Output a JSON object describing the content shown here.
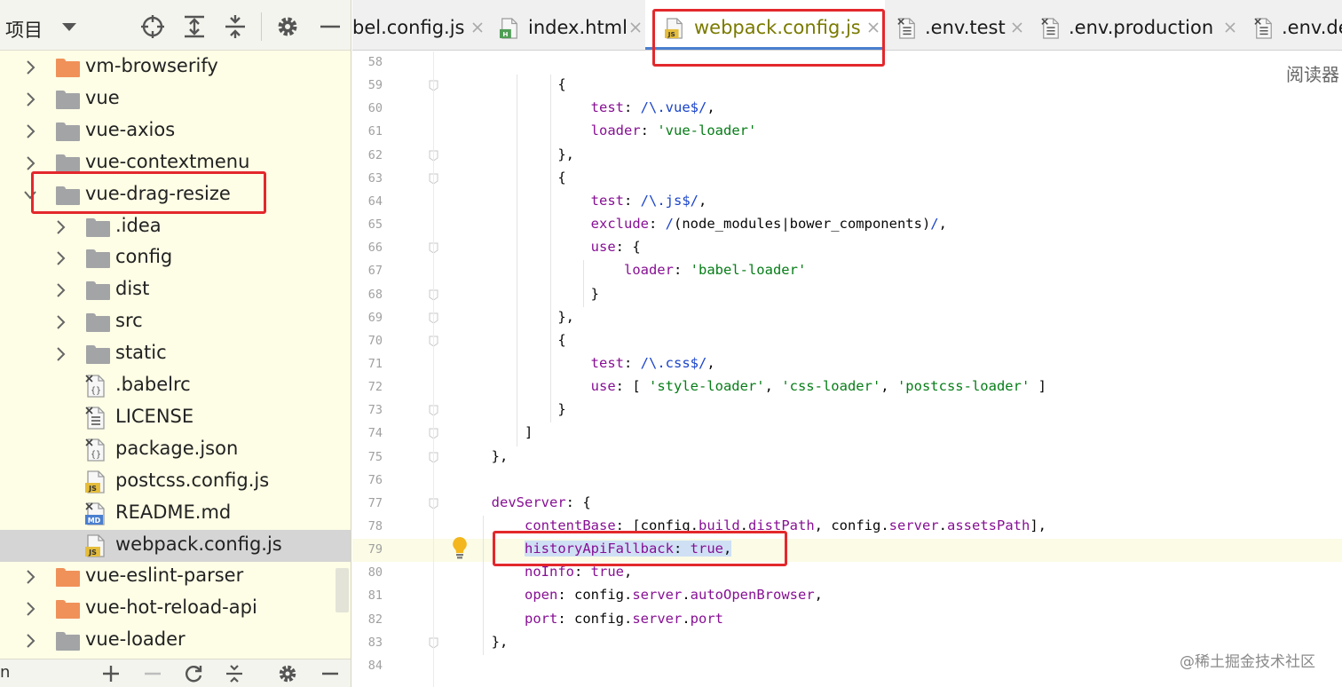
{
  "sidebar": {
    "header": {
      "title": "项目"
    },
    "icons": [
      "crosshair-icon",
      "expand-all-icon",
      "collapse-all-icon",
      "gear-icon",
      "minimize-icon"
    ],
    "tree": [
      {
        "label": "vm-browserify",
        "type": "folder",
        "color": "orange",
        "expanded": false,
        "depth": 0
      },
      {
        "label": "vue",
        "type": "folder",
        "color": "gray",
        "expanded": false,
        "depth": 0
      },
      {
        "label": "vue-axios",
        "type": "folder",
        "color": "gray",
        "expanded": false,
        "depth": 0
      },
      {
        "label": "vue-contextmenu",
        "type": "folder",
        "color": "gray",
        "expanded": false,
        "depth": 0
      },
      {
        "label": "vue-drag-resize",
        "type": "folder",
        "color": "gray",
        "expanded": true,
        "depth": 0,
        "highlighted": true
      },
      {
        "label": ".idea",
        "type": "folder",
        "color": "gray",
        "expanded": false,
        "depth": 1
      },
      {
        "label": "config",
        "type": "folder",
        "color": "gray",
        "expanded": false,
        "depth": 1
      },
      {
        "label": "dist",
        "type": "folder",
        "color": "gray",
        "expanded": false,
        "depth": 1
      },
      {
        "label": "src",
        "type": "folder",
        "color": "gray",
        "expanded": false,
        "depth": 1
      },
      {
        "label": "static",
        "type": "folder",
        "color": "gray",
        "expanded": false,
        "depth": 1
      },
      {
        "label": ".babelrc",
        "type": "file",
        "icon": "json-file-icon",
        "depth": 1
      },
      {
        "label": "LICENSE",
        "type": "file",
        "icon": "text-file-icon",
        "depth": 1
      },
      {
        "label": "package.json",
        "type": "file",
        "icon": "json-file-icon",
        "depth": 1
      },
      {
        "label": "postcss.config.js",
        "type": "file",
        "icon": "js-file-icon",
        "depth": 1
      },
      {
        "label": "README.md",
        "type": "file",
        "icon": "markdown-file-icon",
        "depth": 1
      },
      {
        "label": "webpack.config.js",
        "type": "file",
        "icon": "js-file-icon",
        "depth": 1,
        "selected": true
      },
      {
        "label": "vue-eslint-parser",
        "type": "folder",
        "color": "orange",
        "expanded": false,
        "depth": 0
      },
      {
        "label": "vue-hot-reload-api",
        "type": "folder",
        "color": "orange",
        "expanded": false,
        "depth": 0
      },
      {
        "label": "vue-loader",
        "type": "folder",
        "color": "gray",
        "expanded": false,
        "depth": 0
      }
    ],
    "bottom": {
      "text": "n",
      "icons": [
        "add-icon",
        "remove-icon",
        "refresh-icon",
        "collapse-icon",
        "gear-icon",
        "minimize-icon"
      ]
    }
  },
  "tabs": [
    {
      "label": "bel.config.js",
      "icon": "",
      "active": false
    },
    {
      "label": "index.html",
      "icon": "html-file-icon",
      "badge": "H",
      "active": false
    },
    {
      "label": "webpack.config.js",
      "icon": "js-file-icon",
      "badge": "JS",
      "active": true
    },
    {
      "label": ".env.test",
      "icon": "text-file-icon",
      "active": false
    },
    {
      "label": ".env.production",
      "icon": "text-file-icon",
      "active": false
    },
    {
      "label": ".env.de",
      "icon": "text-file-icon",
      "active": false
    }
  ],
  "editor": {
    "reader_label": "阅读器",
    "current_line": 79,
    "lines": [
      {
        "n": "58",
        "code": []
      },
      {
        "n": "59",
        "code": [
          [
            "",
            "          {"
          ]
        ]
      },
      {
        "n": "60",
        "code": [
          [
            "",
            "              "
          ],
          [
            "k",
            "test"
          ],
          [
            "",
            ": "
          ],
          [
            "rx",
            "/\\.vue$/"
          ],
          [
            "",
            ","
          ]
        ]
      },
      {
        "n": "61",
        "code": [
          [
            "",
            "              "
          ],
          [
            "k",
            "loader"
          ],
          [
            "",
            ": "
          ],
          [
            "s",
            "'vue-loader'"
          ]
        ]
      },
      {
        "n": "62",
        "code": [
          [
            "",
            "          },"
          ]
        ]
      },
      {
        "n": "63",
        "code": [
          [
            "",
            "          {"
          ]
        ]
      },
      {
        "n": "64",
        "code": [
          [
            "",
            "              "
          ],
          [
            "k",
            "test"
          ],
          [
            "",
            ": "
          ],
          [
            "rx",
            "/\\.js$/"
          ],
          [
            "",
            ","
          ]
        ]
      },
      {
        "n": "65",
        "code": [
          [
            "",
            "              "
          ],
          [
            "k",
            "exclude"
          ],
          [
            "",
            ": "
          ],
          [
            "rx",
            "/"
          ],
          [
            "",
            "(node_modules|bower_components)"
          ],
          [
            "rx",
            "/"
          ],
          [
            "",
            ","
          ]
        ]
      },
      {
        "n": "66",
        "code": [
          [
            "",
            "              "
          ],
          [
            "k",
            "use"
          ],
          [
            "",
            ": {"
          ]
        ]
      },
      {
        "n": "67",
        "code": [
          [
            "",
            "                  "
          ],
          [
            "k",
            "loader"
          ],
          [
            "",
            ": "
          ],
          [
            "s",
            "'babel-loader'"
          ]
        ]
      },
      {
        "n": "68",
        "code": [
          [
            "",
            "              }"
          ]
        ]
      },
      {
        "n": "69",
        "code": [
          [
            "",
            "          },"
          ]
        ]
      },
      {
        "n": "70",
        "code": [
          [
            "",
            "          {"
          ]
        ]
      },
      {
        "n": "71",
        "code": [
          [
            "",
            "              "
          ],
          [
            "k",
            "test"
          ],
          [
            "",
            ": "
          ],
          [
            "rx",
            "/\\.css$/"
          ],
          [
            "",
            ","
          ]
        ]
      },
      {
        "n": "72",
        "code": [
          [
            "",
            "              "
          ],
          [
            "k",
            "use"
          ],
          [
            "",
            ": [ "
          ],
          [
            "s",
            "'style-loader'"
          ],
          [
            "",
            ", "
          ],
          [
            "s",
            "'css-loader'"
          ],
          [
            "",
            ", "
          ],
          [
            "s",
            "'postcss-loader'"
          ],
          [
            "",
            " ]"
          ]
        ]
      },
      {
        "n": "73",
        "code": [
          [
            "",
            "          }"
          ]
        ]
      },
      {
        "n": "74",
        "code": [
          [
            "",
            "      ]"
          ]
        ]
      },
      {
        "n": "75",
        "code": [
          [
            "",
            "  },"
          ]
        ]
      },
      {
        "n": "76",
        "code": []
      },
      {
        "n": "77",
        "code": [
          [
            "",
            "  "
          ],
          [
            "k",
            "devServer"
          ],
          [
            "",
            ": {"
          ]
        ]
      },
      {
        "n": "78",
        "code": [
          [
            "",
            "      "
          ],
          [
            "k",
            "contentBase"
          ],
          [
            "",
            ": ["
          ],
          [
            "",
            "config"
          ],
          [
            "",
            "."
          ],
          [
            "k",
            "build"
          ],
          [
            "",
            "."
          ],
          [
            "k",
            "distPath"
          ],
          [
            "",
            ", config."
          ],
          [
            "k",
            "server"
          ],
          [
            "",
            "."
          ],
          [
            "k",
            "assetsPath"
          ],
          [
            "",
            "],"
          ]
        ]
      },
      {
        "n": "79",
        "code": [
          [
            "",
            "      "
          ],
          [
            "k hl",
            "historyApiFallback"
          ],
          [
            "hl",
            ": "
          ],
          [
            "k hl",
            "true"
          ],
          [
            "hl",
            ","
          ]
        ]
      },
      {
        "n": "80",
        "code": [
          [
            "",
            "      "
          ],
          [
            "k",
            "noInfo"
          ],
          [
            "",
            ": "
          ],
          [
            "k",
            "true"
          ],
          [
            "",
            ","
          ]
        ]
      },
      {
        "n": "81",
        "code": [
          [
            "",
            "      "
          ],
          [
            "k",
            "open"
          ],
          [
            "",
            ": config."
          ],
          [
            "k",
            "server"
          ],
          [
            "",
            "."
          ],
          [
            "k",
            "autoOpenBrowser"
          ],
          [
            "",
            ","
          ]
        ]
      },
      {
        "n": "82",
        "code": [
          [
            "",
            "      "
          ],
          [
            "k",
            "port"
          ],
          [
            "",
            ": config."
          ],
          [
            "k",
            "server"
          ],
          [
            "",
            "."
          ],
          [
            "k",
            "port"
          ]
        ]
      },
      {
        "n": "83",
        "code": [
          [
            "",
            "  },"
          ]
        ]
      },
      {
        "n": "84",
        "code": []
      }
    ]
  },
  "watermark": "@稀土掘金技术社区",
  "colors": {
    "annotation_red": "#e3282c",
    "accent_blue": "#4a7fcf",
    "sidebar_bg": "#fefee6",
    "keyword": "#871094",
    "string": "#067d17",
    "regex": "#1a44c8"
  }
}
